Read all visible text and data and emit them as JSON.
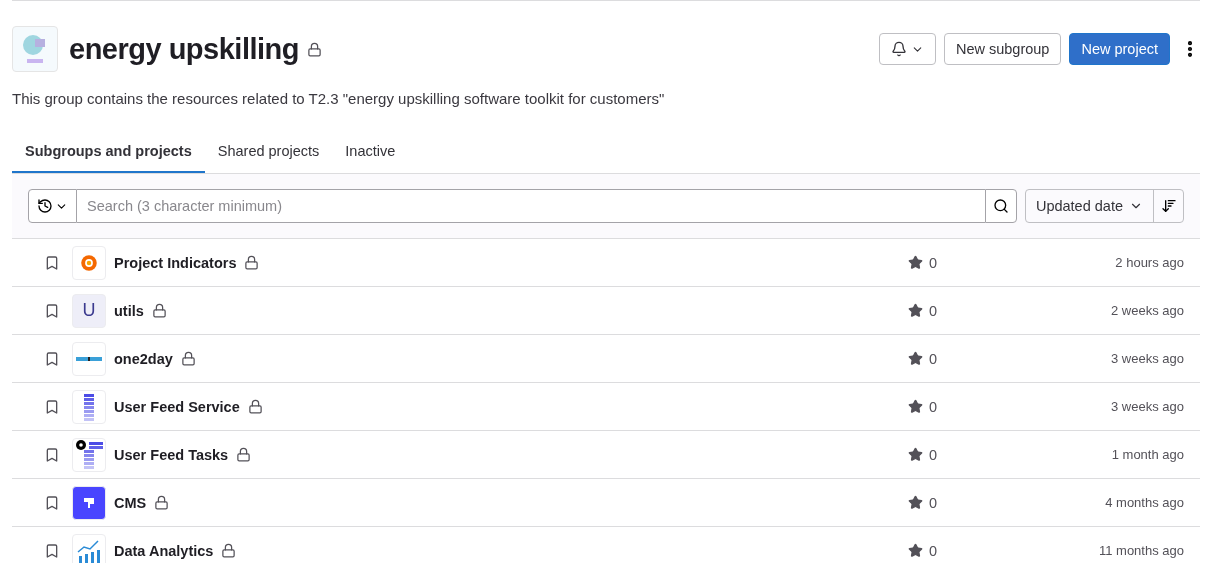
{
  "group": {
    "title": "energy upskilling",
    "private": true,
    "description": "This group contains the resources related to T2.3 \"energy upskilling software toolkit for customers\""
  },
  "actions": {
    "new_subgroup": "New subgroup",
    "new_project": "New project"
  },
  "tabs": [
    {
      "label": "Subgroups and projects",
      "selected": true
    },
    {
      "label": "Shared projects",
      "selected": false
    },
    {
      "label": "Inactive",
      "selected": false
    }
  ],
  "search": {
    "placeholder": "Search (3 character minimum)"
  },
  "sort": {
    "label": "Updated date"
  },
  "projects": [
    {
      "name": "Project Indicators",
      "kind": "grafana",
      "private": true,
      "star_count": "0",
      "updated": "2 hours ago"
    },
    {
      "name": "utils",
      "kind": "letter",
      "avatar_text": "U",
      "private": true,
      "star_count": "0",
      "updated": "2 weeks ago"
    },
    {
      "name": "one2day",
      "kind": "wordmark",
      "private": true,
      "star_count": "0",
      "updated": "3 weeks ago"
    },
    {
      "name": "User Feed Service",
      "kind": "bars",
      "private": true,
      "star_count": "0",
      "updated": "3 weeks ago"
    },
    {
      "name": "User Feed Tasks",
      "kind": "gearbars",
      "private": true,
      "star_count": "0",
      "updated": "1 month ago"
    },
    {
      "name": "CMS",
      "kind": "cms",
      "private": true,
      "star_count": "0",
      "updated": "4 months ago"
    },
    {
      "name": "Data Analytics",
      "kind": "chart",
      "private": true,
      "star_count": "0",
      "updated": "11 months ago"
    }
  ]
}
